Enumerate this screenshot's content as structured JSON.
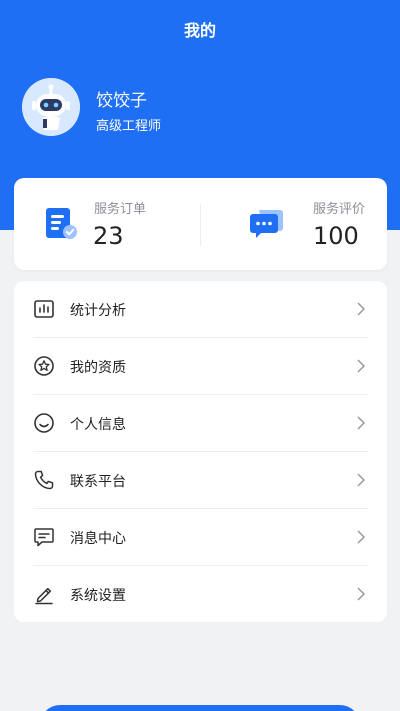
{
  "header": {
    "title": "我的"
  },
  "profile": {
    "name": "饺饺子",
    "role": "高级工程师"
  },
  "stats": {
    "orders": {
      "label": "服务订单",
      "value": "23"
    },
    "reviews": {
      "label": "服务评价",
      "value": "100"
    }
  },
  "menu": {
    "items": [
      {
        "label": "统计分析",
        "icon": "chart-icon"
      },
      {
        "label": "我的资质",
        "icon": "star-badge-icon"
      },
      {
        "label": "个人信息",
        "icon": "smile-icon"
      },
      {
        "label": "联系平台",
        "icon": "phone-icon"
      },
      {
        "label": "消息中心",
        "icon": "message-icon"
      },
      {
        "label": "系统设置",
        "icon": "pencil-icon"
      }
    ]
  },
  "colors": {
    "primary": "#1f6ff5",
    "background": "#f1f2f4",
    "card": "#ffffff"
  }
}
